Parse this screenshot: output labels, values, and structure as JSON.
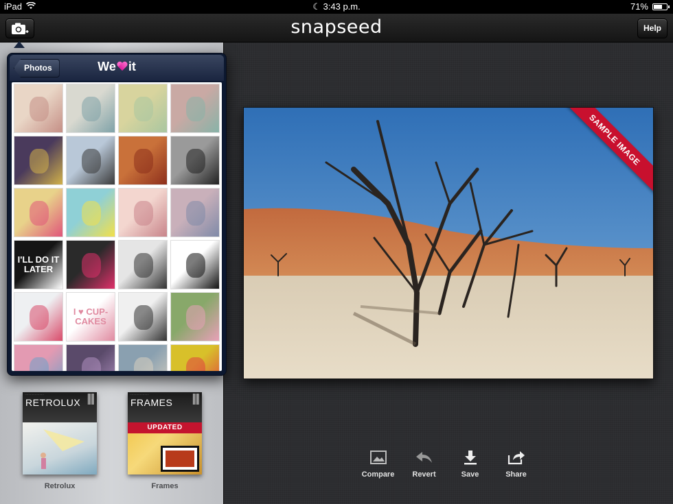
{
  "status_bar": {
    "device": "iPad",
    "time": "3:43 p.m.",
    "battery_percent": "71%",
    "battery_level": 0.71
  },
  "navbar": {
    "logo": "snapseed",
    "camera_icon": "camera-add-icon",
    "help_label": "Help"
  },
  "popover": {
    "back_label": "Photos",
    "title_prefix": "We",
    "title_suffix": "it",
    "title_icon": "heart-icon",
    "thumbnails": [
      {
        "text": "",
        "bg": "#e9d6c6",
        "fg": "#c58f86"
      },
      {
        "text": "",
        "bg": "#d9d9d0",
        "fg": "#7fa2a8"
      },
      {
        "text": "",
        "bg": "#d8d49e",
        "fg": "#a9c6a0"
      },
      {
        "text": "",
        "bg": "#c9a9a4",
        "fg": "#88b3a8"
      },
      {
        "text": "",
        "bg": "#4a3a5c",
        "fg": "#d1b14a"
      },
      {
        "text": "",
        "bg": "#b9c8d8",
        "fg": "#3b3b3b"
      },
      {
        "text": "",
        "bg": "#c9713a",
        "fg": "#8d2f1c"
      },
      {
        "text": "",
        "bg": "#9a9a9a",
        "fg": "#222222"
      },
      {
        "text": "",
        "bg": "#e8d28a",
        "fg": "#e0557a"
      },
      {
        "text": "",
        "bg": "#8fd0d6",
        "fg": "#f2e04a"
      },
      {
        "text": "",
        "bg": "#f3d6cf",
        "fg": "#c8848a"
      },
      {
        "text": "",
        "bg": "#c9b0ba",
        "fg": "#7f8aa8"
      },
      {
        "text": "I'LL DO IT LATER",
        "bg": "#151515",
        "fg": "#ffffff"
      },
      {
        "text": "",
        "bg": "#2a2a2a",
        "fg": "#e0306a"
      },
      {
        "text": "",
        "bg": "#e5e5e5",
        "fg": "#333333"
      },
      {
        "text": "",
        "bg": "#ffffff",
        "fg": "#111111"
      },
      {
        "text": "",
        "bg": "#eef0f2",
        "fg": "#d94b6a"
      },
      {
        "text": "I ♥ CUP-CAKES",
        "bg": "#ffffff",
        "fg": "#e08aa0"
      },
      {
        "text": "",
        "bg": "#f0f0f0",
        "fg": "#333333"
      },
      {
        "text": "",
        "bg": "#88a86a",
        "fg": "#e8a0b8"
      },
      {
        "text": "",
        "bg": "#e39ab2",
        "fg": "#6fa0c8"
      },
      {
        "text": "",
        "bg": "#5a4a6a",
        "fg": "#b090c0"
      },
      {
        "text": "",
        "bg": "#8aa0b0",
        "fg": "#d8d0c0"
      },
      {
        "text": "",
        "bg": "#d8c02a",
        "fg": "#e04040"
      }
    ]
  },
  "left_panel": {
    "tiles": [
      {
        "title": "RETROLUX",
        "caption": "Retrolux"
      },
      {
        "title": "FRAMES",
        "badge": "UPDATED",
        "caption": "Frames"
      }
    ]
  },
  "main": {
    "ribbon_text": "SAMPLE IMAGE",
    "actions": [
      {
        "label": "Compare",
        "icon": "image-compare-icon"
      },
      {
        "label": "Revert",
        "icon": "revert-arrow-icon"
      },
      {
        "label": "Save",
        "icon": "download-save-icon"
      },
      {
        "label": "Share",
        "icon": "share-arrow-icon"
      }
    ]
  }
}
